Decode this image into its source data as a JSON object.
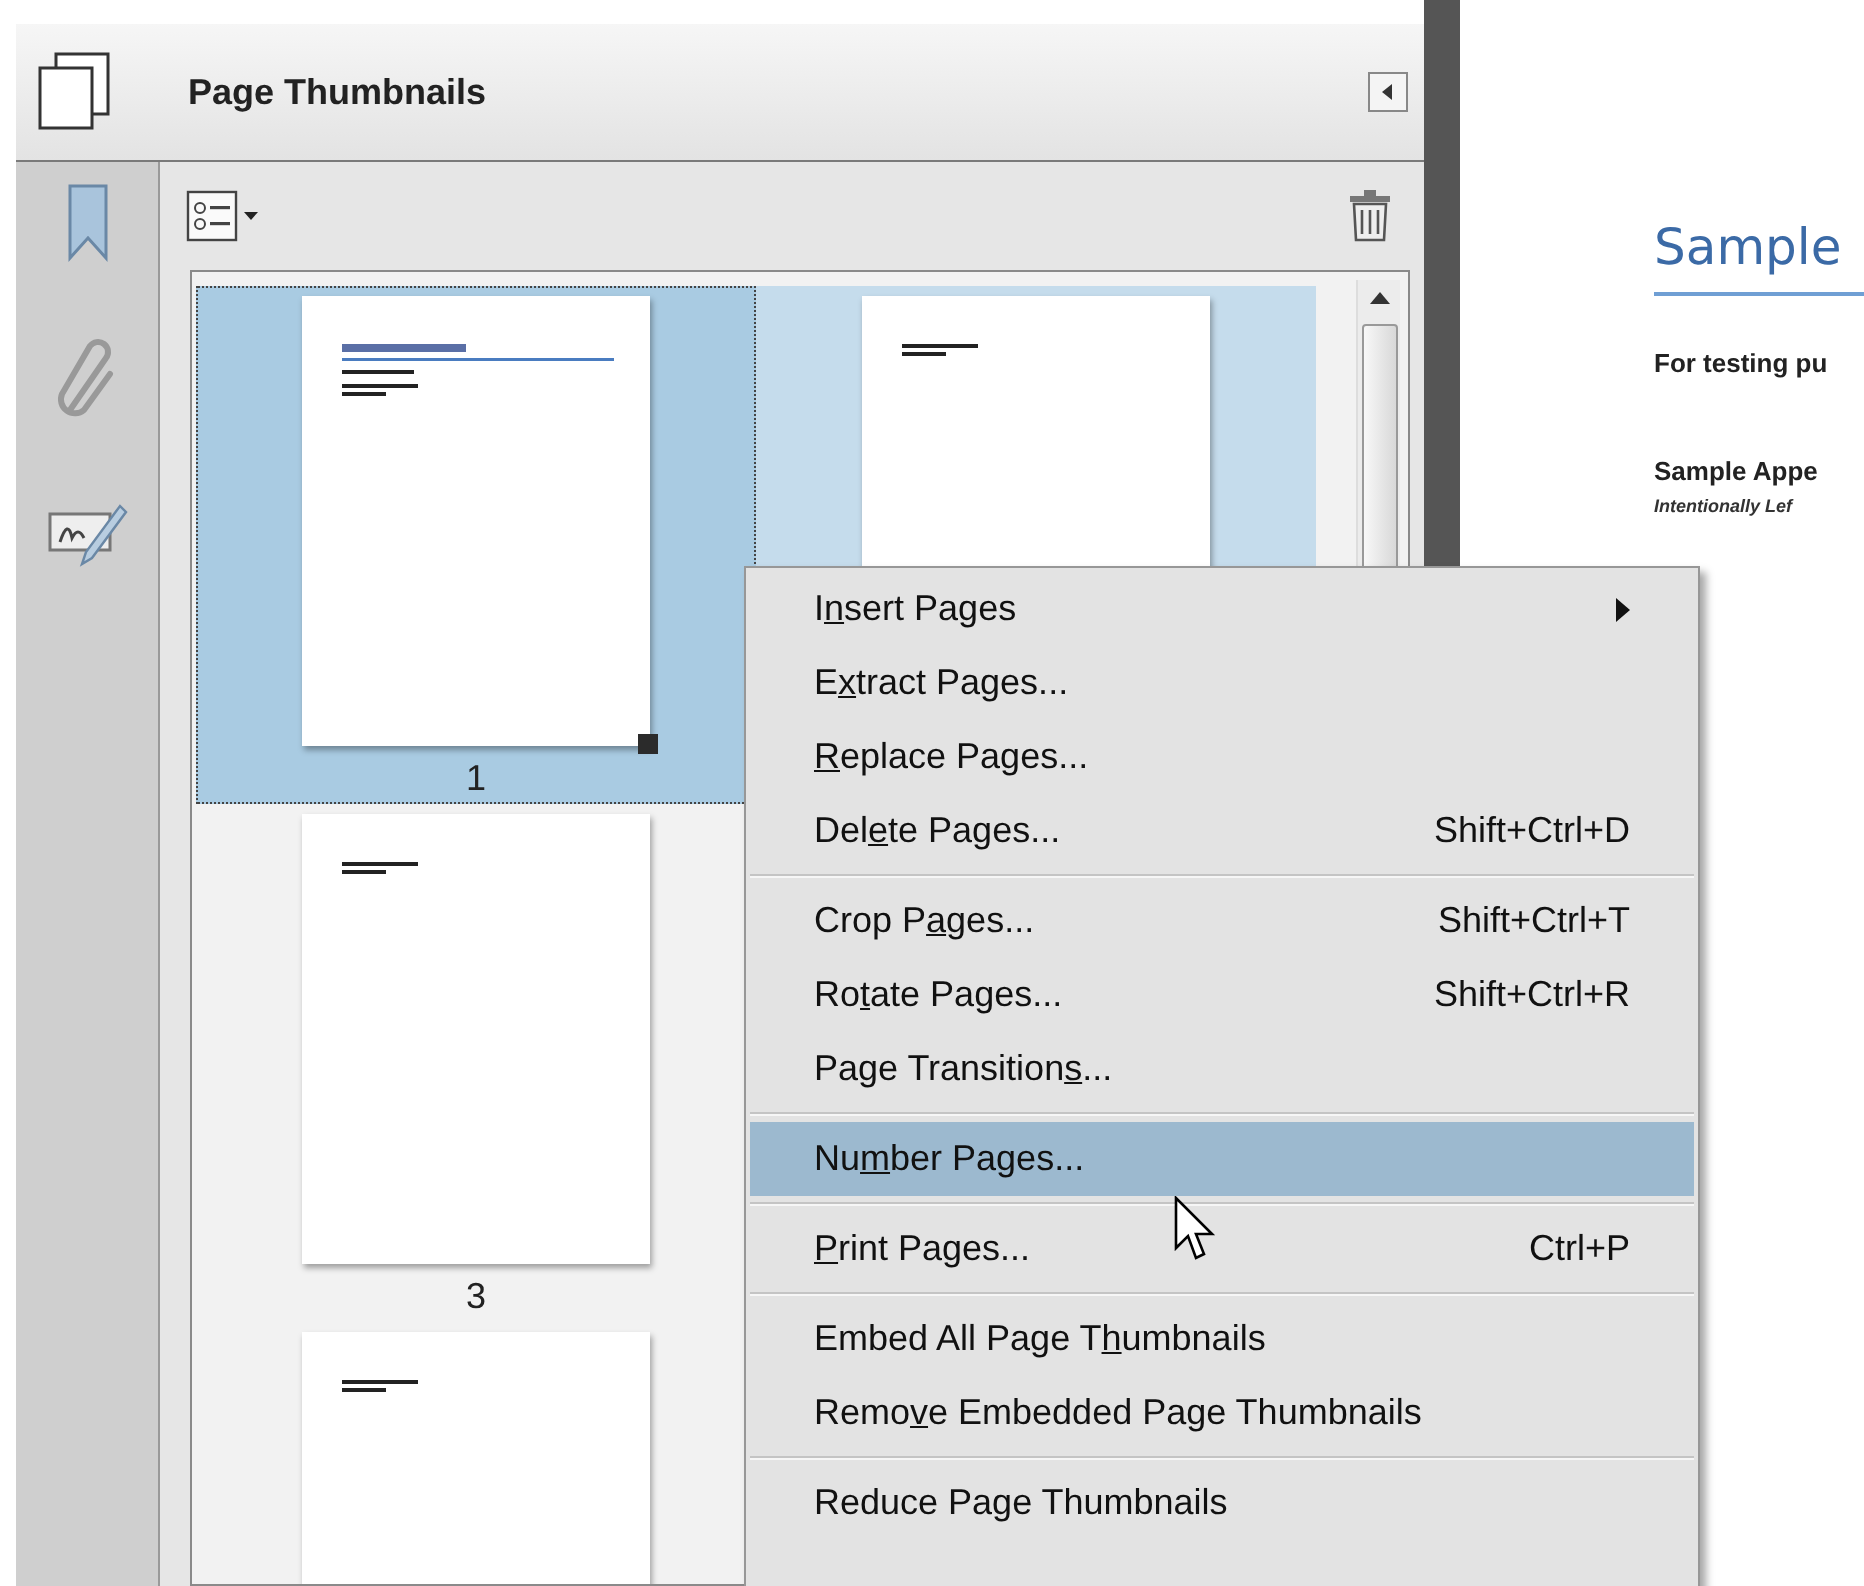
{
  "panel": {
    "title": "Page Thumbnails"
  },
  "thumbnail_columns": [
    [
      {
        "kind": "title_page",
        "label": "1",
        "selected": true,
        "focused": true
      },
      {
        "kind": "text_page",
        "label": "3",
        "selected": false,
        "focused": false
      },
      {
        "kind": "text_page",
        "selected": false,
        "focused": false
      }
    ],
    [
      {
        "kind": "text_page",
        "selected": true,
        "focused": false
      }
    ]
  ],
  "context_menu": [
    {
      "kind": "item",
      "label": {
        "pre": "I",
        "key": "n",
        "post": "sert Pages"
      },
      "submenu": true,
      "selected": false
    },
    {
      "kind": "item",
      "label": {
        "pre": "E",
        "key": "x",
        "post": "tract Pages..."
      },
      "submenu": false,
      "selected": false
    },
    {
      "kind": "item",
      "label": {
        "key": "R",
        "post": "eplace Pages..."
      },
      "submenu": false,
      "selected": false
    },
    {
      "kind": "item",
      "label": {
        "pre": "Del",
        "key": "e",
        "post": "te Pages..."
      },
      "shortcut": "Shift+Ctrl+D",
      "submenu": false,
      "selected": false
    },
    {
      "kind": "separator"
    },
    {
      "kind": "item",
      "label": {
        "pre": "Crop P",
        "key": "a",
        "post": "ges..."
      },
      "shortcut": "Shift+Ctrl+T",
      "submenu": false,
      "selected": false
    },
    {
      "kind": "item",
      "label": {
        "pre": "Ro",
        "key": "t",
        "post": "ate Pages..."
      },
      "shortcut": "Shift+Ctrl+R",
      "submenu": false,
      "selected": false
    },
    {
      "kind": "item",
      "label": {
        "pre": "Page Transition",
        "key": "s",
        "post": "..."
      },
      "submenu": false,
      "selected": false
    },
    {
      "kind": "separator"
    },
    {
      "kind": "item",
      "label": {
        "pre": "Nu",
        "key": "m",
        "post": "ber Pages..."
      },
      "submenu": false,
      "selected": true
    },
    {
      "kind": "separator"
    },
    {
      "kind": "item",
      "label": {
        "key": "P",
        "post": "rint Pages..."
      },
      "shortcut": "Ctrl+P",
      "submenu": false,
      "selected": false
    },
    {
      "kind": "separator"
    },
    {
      "kind": "item",
      "label": {
        "pre": "Embed All Page T",
        "key": "h",
        "post": "umbnails"
      },
      "submenu": false,
      "selected": false
    },
    {
      "kind": "item",
      "label": {
        "pre": "Remo",
        "key": "v",
        "post": "e Embedded Page Thumbnails"
      },
      "submenu": false,
      "selected": false
    },
    {
      "kind": "separator"
    },
    {
      "kind": "item",
      "label": {
        "pre": "Reduce Page Thumbnails"
      },
      "submenu": false,
      "selected": false
    }
  ],
  "document": {
    "heading": "Sample",
    "subtitle": "For testing pu",
    "page_label": "Sample Appe",
    "note": "Intentionally Lef"
  }
}
